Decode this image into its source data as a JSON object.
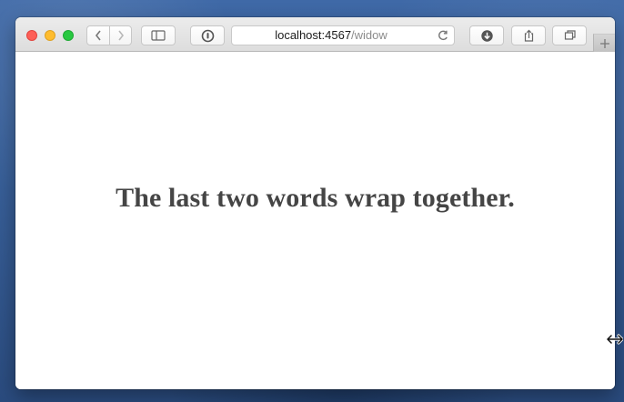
{
  "browser": {
    "url_host": "localhost:4567",
    "url_path": "/widow",
    "toolbar": {
      "back_icon": "chevron-left-icon",
      "forward_icon": "chevron-right-icon",
      "sidebar_icon": "sidebar-icon",
      "password_icon": "password-manager-icon",
      "downloads_icon": "download-icon",
      "share_icon": "share-icon",
      "tabs_icon": "tabs-icon",
      "reload_icon": "reload-icon",
      "new_tab_icon": "plus-icon"
    }
  },
  "page": {
    "headline": "The last two words wrap together."
  },
  "cursor": {
    "type": "horizontal-resize-cursor"
  },
  "colors": {
    "desktop": "#3f69a7",
    "window_toolbar": "#e5e5e5",
    "page_background": "#ffffff",
    "headline": "#454545",
    "close": "#fd5f57",
    "minimize": "#febc2e",
    "zoom": "#28c840"
  }
}
